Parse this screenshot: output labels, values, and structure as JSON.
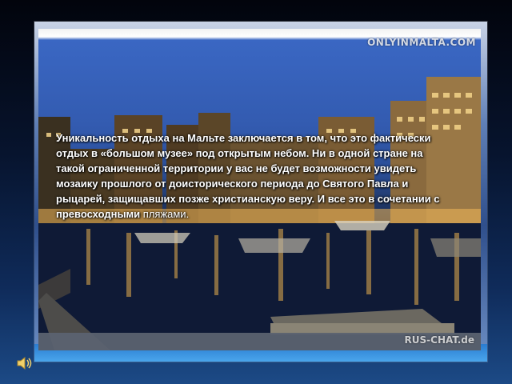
{
  "slide": {
    "text_main": "Уникальность отдыха на Мальте заключается в том, что это фактически отдых в «большом музее» под открытым небом. Ни в одной стране на такой ограниченной территории у вас не будет возможности увидеть мозаику прошлого от доисторического периода до Святого Павла и рыцарей, защищавших позже христианскую веру. И все это в сочетании с превосходными",
    "text_tail": " пляжами.",
    "photo_caption_top": "ONLYINMALTA.COM",
    "photo_caption_bottom": "RUS-CHAT.de"
  },
  "icons": {
    "sound": "speaker-icon"
  },
  "colors": {
    "text": "#ffffff",
    "background": "#07142e",
    "frame_bottom": "#3a97e0"
  }
}
